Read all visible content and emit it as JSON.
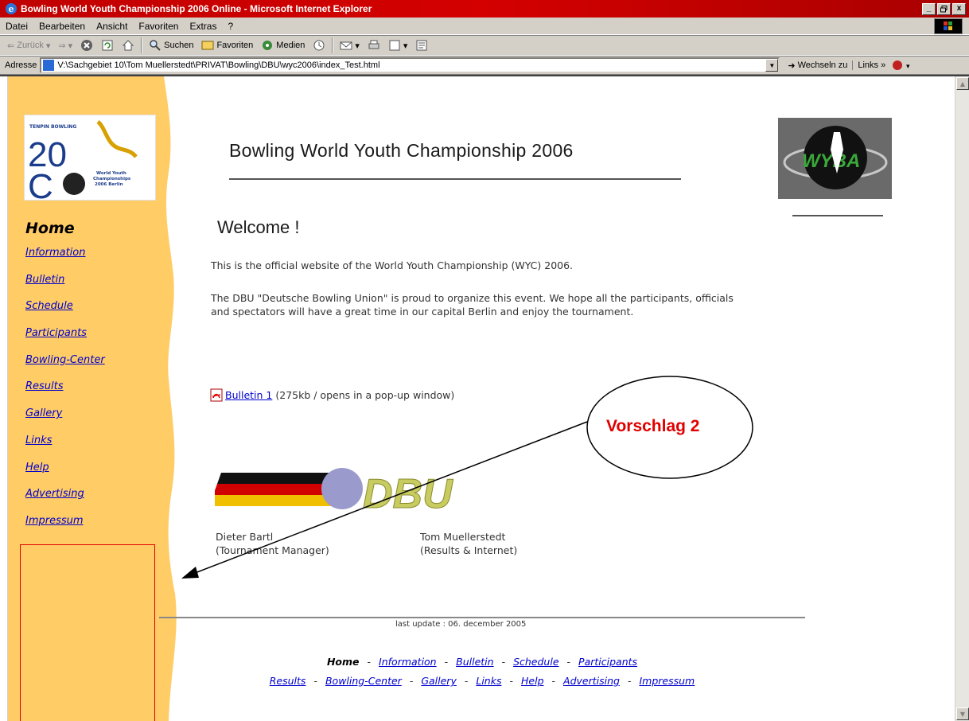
{
  "window": {
    "title": "Bowling World Youth Championship 2006 Online - Microsoft Internet Explorer",
    "buttons": [
      "_",
      "̅",
      "x"
    ]
  },
  "menu": [
    "Datei",
    "Bearbeiten",
    "Ansicht",
    "Favoriten",
    "Extras",
    "?"
  ],
  "toolbar": {
    "back": "Zurück",
    "search": "Suchen",
    "favorites": "Favoriten",
    "media": "Medien"
  },
  "address": {
    "label": "Adresse",
    "url": "V:\\Sachgebiet 10\\Tom Muellerstedt\\PRIVAT\\Bowling\\DBU\\wyc2006\\index_Test.html",
    "go": "Wechseln zu",
    "links": "Links"
  },
  "logo_text": {
    "top": "TENPIN BOWLING",
    "year_a": "20",
    "year_b": "C",
    "sub1": "World Youth",
    "sub2": "Championships",
    "sub3": "2006 Berlin"
  },
  "nav": {
    "home": "Home",
    "items": [
      "Information",
      "Bulletin",
      "Schedule",
      "Participants",
      "Bowling-Center",
      "Results",
      "Gallery",
      "Links",
      "Help",
      "Advertising",
      "Impressum"
    ]
  },
  "main": {
    "headline": "Bowling World Youth Championship 2006",
    "welcome": "Welcome !",
    "p1": "This is the official website of the World Youth Championship (WYC) 2006.",
    "p2": "The DBU \"Deutsche Bowling Union\" is proud to organize this event. We hope all the participants, officials and spectators will have a great time in our capital Berlin and enjoy the tournament.",
    "bulletin_link": "Bulletin 1",
    "bulletin_note": "(275kb / opens in a pop-up window)",
    "dbu_text": "DBU",
    "wyba_text": "WYBA",
    "person_left_name": "Dieter Bartl",
    "person_left_role": "(Tournament Manager)",
    "person_right_name": "Tom Muellerstedt",
    "person_right_role": "(Results & Internet)",
    "last_update": "last update : 06. december 2005"
  },
  "footer": {
    "home": "Home",
    "line1": [
      "Information",
      "Bulletin",
      "Schedule",
      "Participants"
    ],
    "line2": [
      "Results",
      "Bowling-Center",
      "Gallery",
      "Links",
      "Help",
      "Advertising",
      "Impressum"
    ],
    "separator": "-"
  },
  "annotation": {
    "label": "Vorschlag 2"
  },
  "colors": {
    "sidebar": "#ffcc66",
    "link": "#0000cc",
    "annotation": "#e00000",
    "titlebar": "#c00000"
  }
}
